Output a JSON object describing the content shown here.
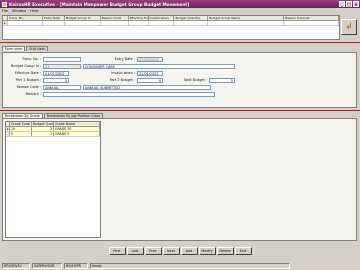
{
  "window": {
    "title": "KairosHR Executive - [Maintain Manpower Budget Group Budget Movement]",
    "minimize_glyph": "_",
    "maximize_glyph": "□",
    "close_glyph": "×"
  },
  "menu": [
    "File",
    "Window",
    "Help"
  ],
  "top_grid": {
    "columns": [
      "",
      "Trans. No.",
      "Entry Date",
      "Budget Group Id",
      "Reason Code",
      "Effective From",
      "Invalid when",
      "Budget Quantity",
      "Budget Group Name",
      "Reason Descript"
    ],
    "row_marker": "▸"
  },
  "refresh_icon_glyph": "↲",
  "form_tabs": [
    "Form view",
    "Grid view"
  ],
  "form": {
    "trans_no": {
      "label": "Trans. No. :",
      "value": ""
    },
    "entry_date": {
      "label": "Entry Date :",
      "value": "27/01/2003"
    },
    "budget_group_id": {
      "label": "Budget Group Id :",
      "value": "21",
      "name": "CONSUMER CARE"
    },
    "effective_date": {
      "label": "Effective Date :",
      "value": "01/01/2002"
    },
    "invalid_when": {
      "label": "Invalid when :",
      "value": "31/01/2002"
    },
    "part1_budget": {
      "label": "Part 1 Budget :",
      "value": "5"
    },
    "part2_budget": {
      "label": "Part 2 Budget :",
      "value": "0"
    },
    "total_budget": {
      "label": "Total Budget :",
      "value": "5"
    },
    "reason_code": {
      "label": "Reason Code :",
      "value": "ANNUAL",
      "description": "ANNUAL SUBMITTED"
    },
    "remark": {
      "label": "Remark :",
      "value": ""
    }
  },
  "detail_tabs": [
    "Breakdown By Grade",
    "Breakdown By Job Position Class"
  ],
  "grade_grid": {
    "columns": [
      "Grade Code",
      "Budget Quantity",
      "Grade Name"
    ],
    "rows": [
      {
        "marker": "▸",
        "code": "10",
        "qty": "3",
        "name": "GRADE 10"
      },
      {
        "marker": "",
        "code": "5",
        "qty": "2",
        "name": "GRADE 5"
      }
    ]
  },
  "nav_buttons": [
    "First",
    "Last",
    "Prev",
    "Next",
    "Add",
    "Modify",
    "Delete",
    "Exit"
  ],
  "status": [
    "RPVMDVEV",
    "SUPERVISOR",
    "RSVHYPR",
    "Ready"
  ]
}
